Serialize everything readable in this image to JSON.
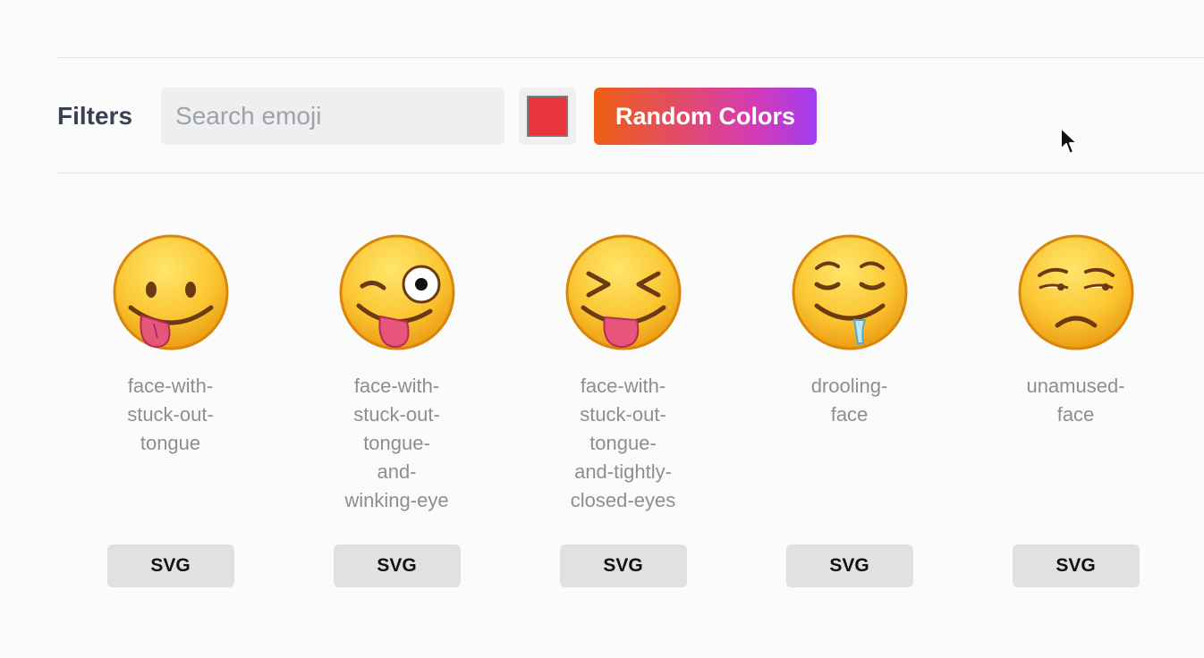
{
  "filters": {
    "label": "Filters",
    "search_placeholder": "Search emoji",
    "search_value": "",
    "selected_color": "#e8343a",
    "random_label": "Random Colors"
  },
  "emojis": [
    {
      "name": "face-with-\nstuck-out-\ntongue",
      "icon": "face-with-stuck-out-tongue-icon",
      "button": "SVG"
    },
    {
      "name": "face-with-\nstuck-out-\ntongue-\nand-\nwinking-eye",
      "icon": "face-with-stuck-out-tongue-and-winking-eye-icon",
      "button": "SVG"
    },
    {
      "name": "face-with-\nstuck-out-\ntongue-\nand-tightly-\nclosed-eyes",
      "icon": "face-with-stuck-out-tongue-and-tightly-closed-eyes-icon",
      "button": "SVG"
    },
    {
      "name": "drooling-\nface",
      "icon": "drooling-face-icon",
      "button": "SVG"
    },
    {
      "name": "unamused-\nface",
      "icon": "unamused-face-icon",
      "button": "SVG"
    }
  ]
}
